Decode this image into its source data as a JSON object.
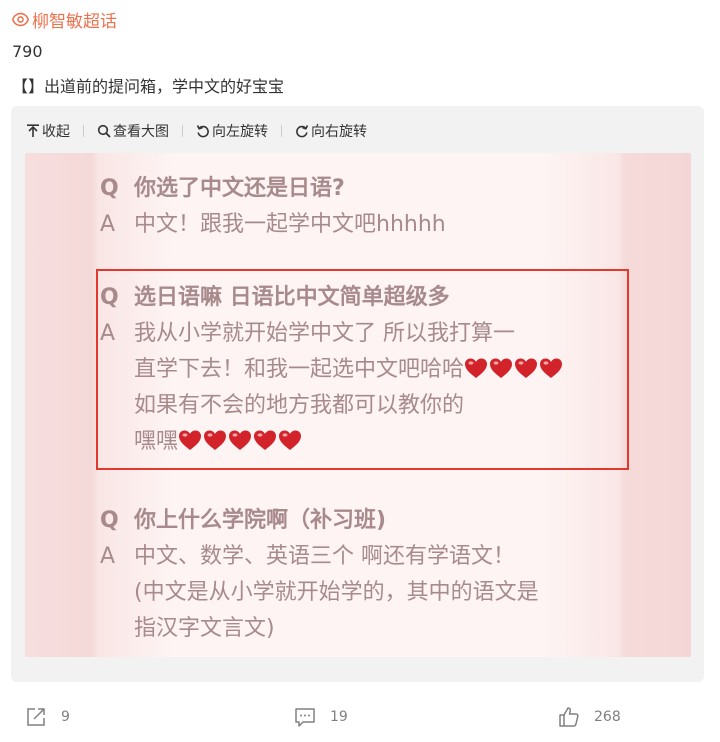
{
  "topic": {
    "label": "柳智敏超话",
    "icon": "topic-icon",
    "color": "#eb7350"
  },
  "post": {
    "number": "790",
    "text": "【】出道前的提问箱，学中文的好宝宝"
  },
  "image_toolbar": {
    "collapse": "收起",
    "view_large": "查看大图",
    "rotate_left": "向左旋转",
    "rotate_right": "向右旋转"
  },
  "image_content": {
    "q1": {
      "q_mark": "Q",
      "q_text": "你选了中文还是日语?",
      "a_mark": "A",
      "a_text": "中文！跟我一起学中文吧hhhhh"
    },
    "q2": {
      "q_mark": "Q",
      "q_text": "选日语嘛  日语比中文简单超级多",
      "a_mark": "A",
      "a_line1": "我从小学就开始学中文了  所以我打算一",
      "a_line2": "直学下去！和我一起选中文吧哈哈",
      "a_line3": "如果有不会的地方我都可以教你的",
      "a_line4": "嘿嘿",
      "hearts_line2": 4,
      "hearts_line4": 5
    },
    "q3": {
      "q_mark": "Q",
      "q_text": "你上什么学院啊（补习班)",
      "a_mark": "A",
      "a_line1": "中文、数学、英语三个  啊还有学语文！",
      "a_line2": "(中文是从小学就开始学的，其中的语文是",
      "a_line3": "指汉字文言文)"
    },
    "highlight_color": "#e03a2e"
  },
  "actions": {
    "share_count": "9",
    "comment_count": "19",
    "like_count": "268"
  }
}
